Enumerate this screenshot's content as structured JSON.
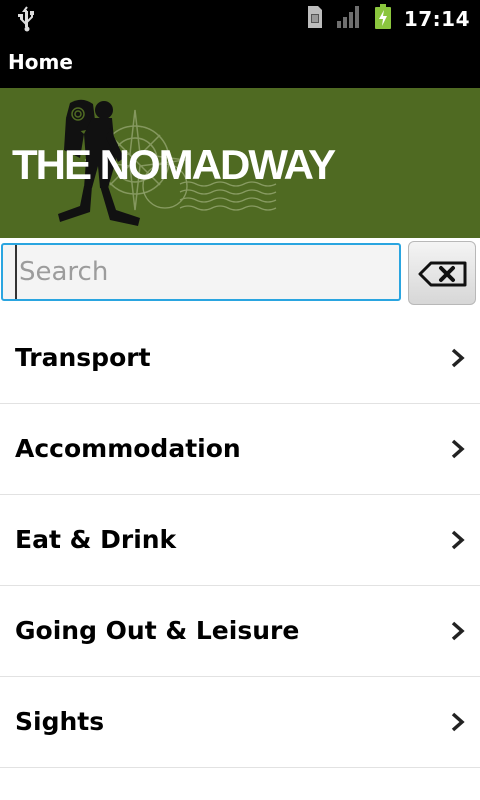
{
  "status_bar": {
    "time": "17:14",
    "icons": [
      "usb-icon",
      "sim-icon",
      "signal-icon",
      "battery-charging-icon"
    ]
  },
  "title_bar": {
    "title": "Home"
  },
  "banner": {
    "logo_text": "THE NOMADWAY"
  },
  "search": {
    "placeholder": "Search",
    "value": "",
    "clear_icon": "backspace-clear-icon"
  },
  "menu": {
    "items": [
      {
        "label": "Transport"
      },
      {
        "label": "Accommodation"
      },
      {
        "label": "Eat & Drink"
      },
      {
        "label": "Going Out & Leisure"
      },
      {
        "label": "Sights"
      }
    ]
  },
  "colors": {
    "status_bar_bg": "#000000",
    "banner_green": "#4f6a22",
    "search_focus": "#2aa5e0",
    "battery_green": "#8bc63e"
  }
}
